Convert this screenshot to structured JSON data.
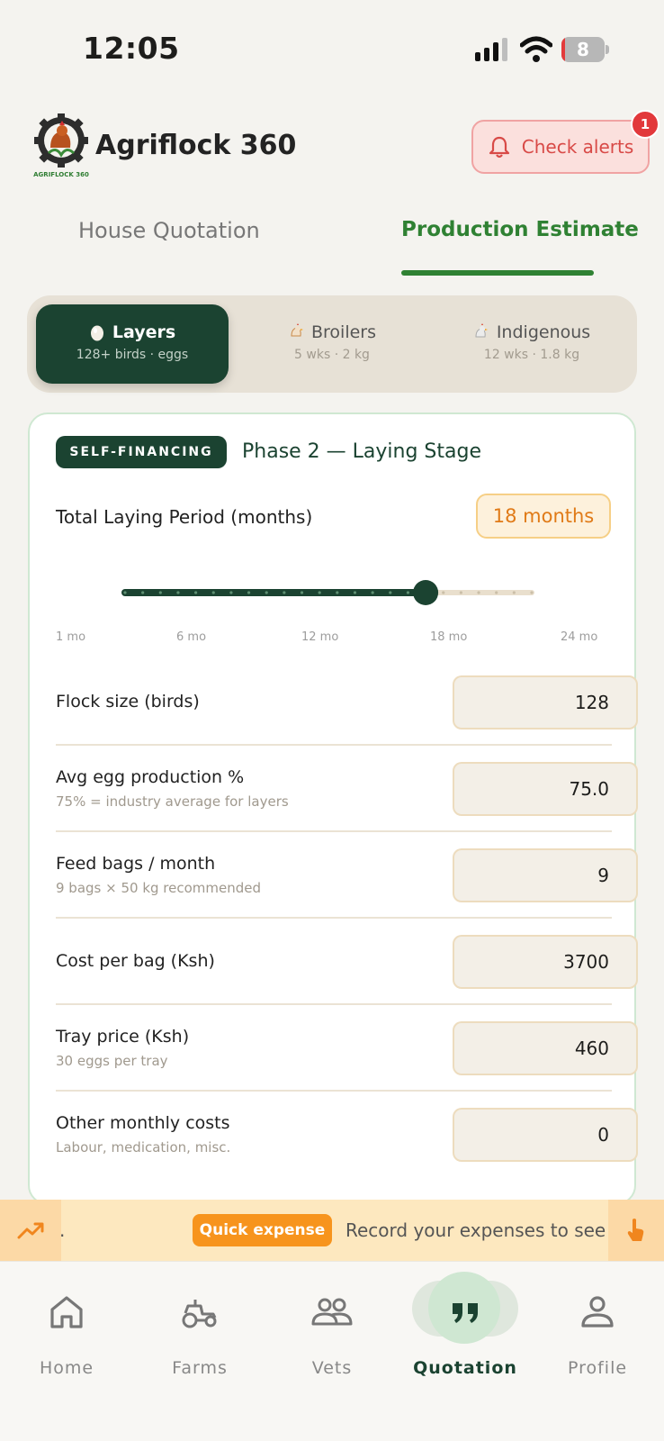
{
  "status_bar": {
    "time": "12:05",
    "battery": "8",
    "battery_level": 0.08
  },
  "header": {
    "app_name": "Agriflock 360",
    "logo_text": "AGRIFLOCK 360",
    "alerts_label": "Check alerts",
    "alerts_count": "1"
  },
  "tabs": [
    {
      "label": "House Quotation",
      "active": false
    },
    {
      "label": "Production Estimate",
      "active": true
    }
  ],
  "bird_types": [
    {
      "label": "Layers",
      "sub": "128+ birds · eggs",
      "icon": "egg-icon",
      "active": true
    },
    {
      "label": "Broilers",
      "sub": "5 wks · 2 kg",
      "icon": "chicken-icon",
      "active": false
    },
    {
      "label": "Indigenous",
      "sub": "12 wks · 1.8 kg",
      "icon": "rooster-icon",
      "active": false
    }
  ],
  "phase": {
    "badge": "SELF-FINANCING",
    "title": "Phase 2 — Laying Stage"
  },
  "period": {
    "label": "Total Laying Period (months)",
    "value_text": "18 months",
    "value": 18,
    "min": 1,
    "max": 24,
    "ticks": [
      "1 mo",
      "6 mo",
      "12 mo",
      "18 mo",
      "24 mo"
    ]
  },
  "fields": [
    {
      "label": "Flock size (birds)",
      "sub": "",
      "value": "128"
    },
    {
      "label": "Avg egg production %",
      "sub": "75% = industry average for layers",
      "value": "75.0"
    },
    {
      "label": "Feed bags / month",
      "sub": "9 bags × 50 kg recommended",
      "value": "9"
    },
    {
      "label": "Cost per bag (Ksh)",
      "sub": "",
      "value": "3700"
    },
    {
      "label": "Tray price (Ksh)",
      "sub": "30 eggs per tray",
      "value": "460"
    },
    {
      "label": "Other monthly costs",
      "sub": "Labour, medication, misc.",
      "value": "0"
    }
  ],
  "ticker": {
    "pill": "Quick expense",
    "text": "Record your expenses to see pr",
    "lead": "."
  },
  "nav": [
    {
      "label": "Home",
      "icon": "home-icon",
      "active": false
    },
    {
      "label": "Farms",
      "icon": "tractor-icon",
      "active": false
    },
    {
      "label": "Vets",
      "icon": "people-icon",
      "active": false
    },
    {
      "label": "Quotation",
      "icon": "quote-icon",
      "active": true
    },
    {
      "label": "Profile",
      "icon": "person-icon",
      "active": false
    }
  ],
  "colors": {
    "primary": "#1b4331",
    "accent_green": "#2f8133",
    "orange": "#f7941d",
    "alert_red": "#e2383b"
  }
}
